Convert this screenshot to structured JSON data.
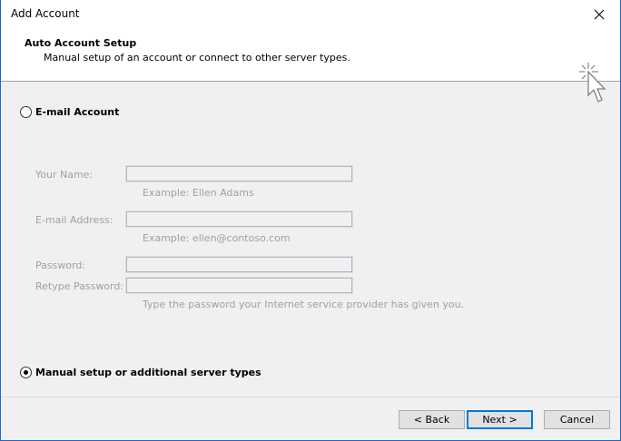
{
  "window": {
    "title": "Add Account",
    "close_symbol": "close-icon"
  },
  "header": {
    "title": "Auto Account Setup",
    "subtitle": "Manual setup of an account or connect to other server types.",
    "icon": "cursor-click-icon"
  },
  "email_account": {
    "label": "E-mail Account",
    "selected": false,
    "fields": {
      "name_label": "Your Name:",
      "name_value": "",
      "name_hint": "Example: Ellen Adams",
      "email_label": "E-mail Address:",
      "email_value": "",
      "email_hint": "Example: ellen@contoso.com",
      "password_label": "Password:",
      "password_value": "",
      "retype_label": "Retype Password:",
      "retype_value": "",
      "password_hint": "Type the password your Internet service provider has given you."
    }
  },
  "manual_setup": {
    "label": "Manual setup or additional server types",
    "selected": true
  },
  "buttons": {
    "back": "< Back",
    "next": "Next >",
    "cancel": "Cancel"
  },
  "colors": {
    "window_border": "#1b6ac9",
    "default_button_border": "#0078d7",
    "disabled_text": "#a0a0a0"
  }
}
